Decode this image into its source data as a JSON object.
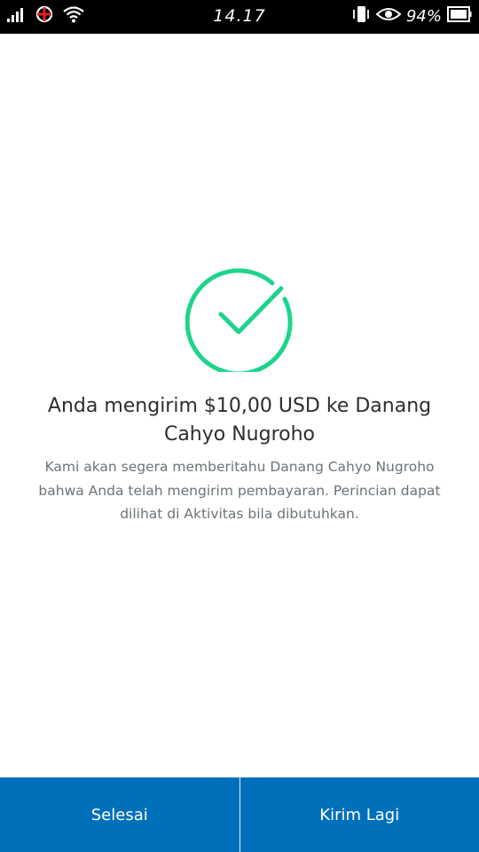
{
  "status_bar": {
    "time": "14.17",
    "battery_percent": "94%",
    "icons": [
      "signal-icon",
      "carrier-icon",
      "wifi-icon",
      "vibrate-icon",
      "eye-icon",
      "battery-icon"
    ]
  },
  "confirmation": {
    "icon": "check-circle-icon",
    "accent_color": "#1ed48c",
    "title": "Anda mengirim $10,00 USD ke Danang Cahyo Nugroho",
    "message": "Kami akan segera memberitahu Danang Cahyo Nugroho bahwa Anda telah mengirim pembayaran. Perincian dapat dilihat di Aktivitas bila dibutuhkan."
  },
  "actions": {
    "done_label": "Selesai",
    "send_again_label": "Kirim Lagi",
    "button_color": "#0070ba"
  }
}
